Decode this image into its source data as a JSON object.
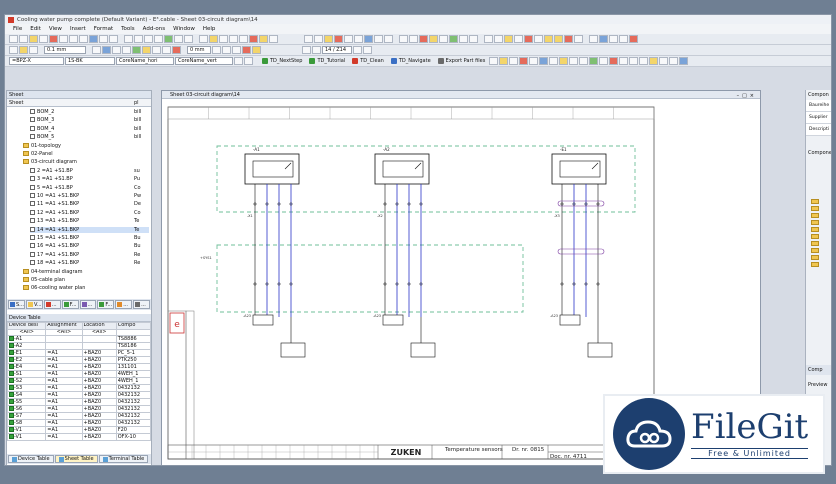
{
  "window": {
    "title": "Cooling water pump complete (Default Variant) - E³.cable - Sheet 03-circuit diagram\\14"
  },
  "menu": [
    "File",
    "Edit",
    "View",
    "Insert",
    "Format",
    "Tools",
    "Add-ons",
    "Window",
    "Help"
  ],
  "toolbar2": {
    "length_value": "0.1 mm",
    "snap_value": "0 mm",
    "page_value": "14 / Z14"
  },
  "toolbar3": {
    "combo1": "=BPZ-X",
    "combo2": "1S-BK",
    "combo3": "CoreName_hori",
    "combo4": "CoreName_vert",
    "buttons": [
      "TD_NextStep",
      "TD_Tutorial",
      "TD_Clean",
      "TD_Navigate",
      "Export Part files"
    ]
  },
  "sheet_panel": {
    "title": "Sheet",
    "col_header": "Sheet",
    "col2_header": "pl",
    "rows": [
      {
        "label": "BOM_2",
        "c": "bill",
        "indent": 3,
        "kind": "doc"
      },
      {
        "label": "BOM_3",
        "c": "bill",
        "indent": 3,
        "kind": "doc"
      },
      {
        "label": "BOM_4",
        "c": "bill",
        "indent": 3,
        "kind": "doc"
      },
      {
        "label": "BOM_5",
        "c": "bill",
        "indent": 3,
        "kind": "doc"
      },
      {
        "label": "01-topology",
        "c": "",
        "indent": 2,
        "kind": "folder"
      },
      {
        "label": "02-Panel",
        "c": "",
        "indent": 2,
        "kind": "folder"
      },
      {
        "label": "03-circuit diagram",
        "c": "",
        "indent": 2,
        "kind": "folder"
      },
      {
        "label": "2 =A1 +S1.BP",
        "c": "su",
        "indent": 3,
        "kind": "doc"
      },
      {
        "label": "3 =A1 +S1.BP",
        "c": "Pu",
        "indent": 3,
        "kind": "doc"
      },
      {
        "label": "5 =A1 +S1.BP",
        "c": "Co",
        "indent": 3,
        "kind": "doc"
      },
      {
        "label": "10 =A1 +S1.BKP",
        "c": "Pw",
        "indent": 3,
        "kind": "doc"
      },
      {
        "label": "11 =A1 +S1.BKP",
        "c": "De",
        "indent": 3,
        "kind": "doc"
      },
      {
        "label": "12 =A1 +S1.BKP",
        "c": "Co",
        "indent": 3,
        "kind": "doc"
      },
      {
        "label": "13 =A1 +S1.BKP",
        "c": "Te",
        "indent": 3,
        "kind": "doc"
      },
      {
        "label": "14 =A1 +S1.BKP",
        "c": "Te",
        "indent": 3,
        "kind": "doc",
        "selected": true
      },
      {
        "label": "15 =A1 +S1.BKP",
        "c": "Bu",
        "indent": 3,
        "kind": "doc"
      },
      {
        "label": "16 =A1 +S1.BKP",
        "c": "Bu",
        "indent": 3,
        "kind": "doc"
      },
      {
        "label": "17 =A1 +S1.BKP",
        "c": "Re",
        "indent": 3,
        "kind": "doc"
      },
      {
        "label": "18 =A1 +S1.BKP",
        "c": "Re",
        "indent": 3,
        "kind": "doc"
      },
      {
        "label": "04-terminal diagram",
        "c": "",
        "indent": 2,
        "kind": "folder"
      },
      {
        "label": "05-cable plan",
        "c": "",
        "indent": 2,
        "kind": "folder"
      },
      {
        "label": "06-cooling water plan",
        "c": "",
        "indent": 2,
        "kind": "folder"
      }
    ]
  },
  "panel_tabs": [
    "S...",
    "V...",
    "...",
    "F...",
    "...",
    "F...",
    "...",
    "..."
  ],
  "device_table": {
    "title": "Device Table",
    "headers": [
      "Device desi",
      "Assignment",
      "Location",
      "Compo"
    ],
    "filter": [
      "<All>",
      "<All>",
      "<All>",
      ""
    ],
    "rows": [
      [
        "-A1",
        "",
        "",
        "TS8886"
      ],
      [
        "-A2",
        "",
        "",
        "TS8186"
      ],
      [
        "-E1",
        "=A1",
        "+BAZ0",
        "PC_5-1"
      ],
      [
        "-E2",
        "=A1",
        "+BAZ0",
        "PTK250"
      ],
      [
        "-E4",
        "=A1",
        "+BAZ0",
        "131101"
      ],
      [
        "-S1",
        "=A1",
        "+BAZ0",
        "4WEH_1"
      ],
      [
        "-S2",
        "=A1",
        "+BAZ0",
        "4WEH_1"
      ],
      [
        "-S3",
        "=A1",
        "+BAZ0",
        "0432132"
      ],
      [
        "-S4",
        "=A1",
        "+BAZ0",
        "0432132"
      ],
      [
        "-S5",
        "=A1",
        "+BAZ0",
        "0432132"
      ],
      [
        "-S6",
        "=A1",
        "+BAZ0",
        "0432132"
      ],
      [
        "-S7",
        "=A1",
        "+BAZ0",
        "0432132"
      ],
      [
        "-S8",
        "=A1",
        "+BAZ0",
        "0432132"
      ],
      [
        "-V1",
        "=A1",
        "+BAZ0",
        "F20"
      ],
      [
        "-V1",
        "=A1",
        "+BAZ0",
        "OFX-10"
      ]
    ]
  },
  "bottom_tabs": [
    "Device Table",
    "Sheet Table",
    "Terminal Table"
  ],
  "sheet_window": {
    "title": "Sheet 03-circuit diagram\\14"
  },
  "drawing": {
    "company": "ZUKEN",
    "sheet_title": "Temperature sensors",
    "dr_nr": "Dr. nr. 0815",
    "doc_nr": "Doc. nr. 4711",
    "devices": [
      "-A1",
      "-A2",
      "-E1"
    ],
    "devices_lower": [
      "-A23",
      "-A23",
      "-A23"
    ],
    "xtail_labels": [
      "-X1",
      "-X2",
      "-X3"
    ],
    "ref_label": "+SYS1"
  },
  "right_panel": {
    "title": "Compon",
    "fields": [
      "Baureihe",
      "Supplier",
      "Descripti"
    ],
    "tree_title": "Compone",
    "bottom_tab": "Comp",
    "preview_label": "Preview"
  },
  "watermark": {
    "title": "FileGit",
    "subtitle": "Free & Unlimited"
  }
}
